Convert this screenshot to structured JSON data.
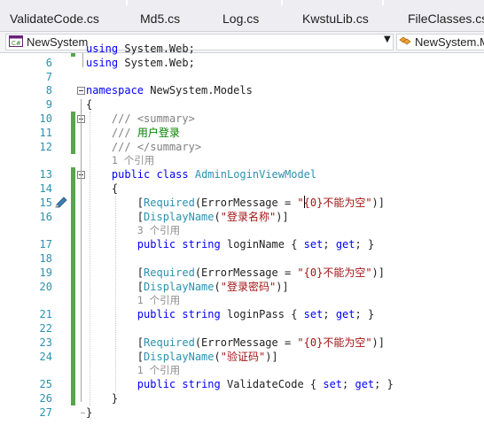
{
  "tabs": [
    "ValidateCode.cs",
    "Md5.cs",
    "Log.cs",
    "KwstuLib.cs",
    "FileClasses.cs"
  ],
  "navbar": {
    "project_combo": "NewSystem",
    "namespace_combo": "NewSystem.Models"
  },
  "editor": {
    "lines": [
      {
        "num": "",
        "ref": false,
        "html": "<span class=\"kw\">using</span> System.Web;"
      },
      {
        "num": "6",
        "ref": false,
        "html": "<span class=\"kw\">using</span> System.Web;"
      },
      {
        "num": "7",
        "ref": false,
        "html": ""
      },
      {
        "num": "8",
        "ref": false,
        "html": "<span class=\"kw\">namespace</span> NewSystem.Models"
      },
      {
        "num": "9",
        "ref": false,
        "html": "{"
      },
      {
        "num": "10",
        "ref": false,
        "html": "    <span class=\"xd\">///</span><span class=\"cm\"> </span><span class=\"xd\">&lt;summary&gt;</span>"
      },
      {
        "num": "11",
        "ref": false,
        "html": "    <span class=\"xd\">///</span><span class=\"cm\"> 用户登录</span>"
      },
      {
        "num": "12",
        "ref": false,
        "html": "    <span class=\"xd\">///</span><span class=\"cm\"> </span><span class=\"xd\">&lt;/summary&gt;</span>"
      },
      {
        "num": "",
        "ref": true,
        "html": "    <span class=\"ref\">1 个引用</span>"
      },
      {
        "num": "13",
        "ref": false,
        "html": "    <span class=\"kw\">public</span> <span class=\"kw\">class</span> <span class=\"ty\">AdminLoginViewModel</span>"
      },
      {
        "num": "14",
        "ref": false,
        "html": "    {"
      },
      {
        "num": "15",
        "ref": false,
        "html": "        [<span class=\"ty\">Required</span>(ErrorMessage = <span class=\"st\">\"{0}不能为空\"</span>)]"
      },
      {
        "num": "16",
        "ref": false,
        "html": "        [<span class=\"ty\">DisplayName</span>(<span class=\"st\">\"登录名称\"</span>)]"
      },
      {
        "num": "",
        "ref": true,
        "html": "        <span class=\"ref\">3 个引用</span>"
      },
      {
        "num": "17",
        "ref": false,
        "html": "        <span class=\"kw\">public</span> <span class=\"kw\">string</span> loginName { <span class=\"kw\">set</span>; <span class=\"kw\">get</span>; }"
      },
      {
        "num": "18",
        "ref": false,
        "html": ""
      },
      {
        "num": "19",
        "ref": false,
        "html": "        [<span class=\"ty\">Required</span>(ErrorMessage = <span class=\"st\">\"{0}不能为空\"</span>)]"
      },
      {
        "num": "20",
        "ref": false,
        "html": "        [<span class=\"ty\">DisplayName</span>(<span class=\"st\">\"登录密码\"</span>)]"
      },
      {
        "num": "",
        "ref": true,
        "html": "        <span class=\"ref\">1 个引用</span>"
      },
      {
        "num": "21",
        "ref": false,
        "html": "        <span class=\"kw\">public</span> <span class=\"kw\">string</span> loginPass { <span class=\"kw\">set</span>; <span class=\"kw\">get</span>; }"
      },
      {
        "num": "22",
        "ref": false,
        "html": ""
      },
      {
        "num": "23",
        "ref": false,
        "html": "        [<span class=\"ty\">Required</span>(ErrorMessage = <span class=\"st\">\"{0}不能为空\"</span>)]"
      },
      {
        "num": "24",
        "ref": false,
        "html": "        [<span class=\"ty\">DisplayName</span>(<span class=\"st\">\"验证码\"</span>)]"
      },
      {
        "num": "",
        "ref": true,
        "html": "        <span class=\"ref\">1 个引用</span>"
      },
      {
        "num": "25",
        "ref": false,
        "html": "        <span class=\"kw\">public</span> <span class=\"kw\">string</span> ValidateCode { <span class=\"kw\">set</span>; <span class=\"kw\">get</span>; }"
      },
      {
        "num": "26",
        "ref": false,
        "html": "    }"
      },
      {
        "num": "27",
        "ref": false,
        "html": "}"
      }
    ]
  },
  "colors": {
    "keyword": "#0000ff",
    "type": "#2b91af",
    "comment": "#008000",
    "string": "#a31515",
    "line_number": "#2b91af",
    "change_bar": "#57a64a"
  }
}
